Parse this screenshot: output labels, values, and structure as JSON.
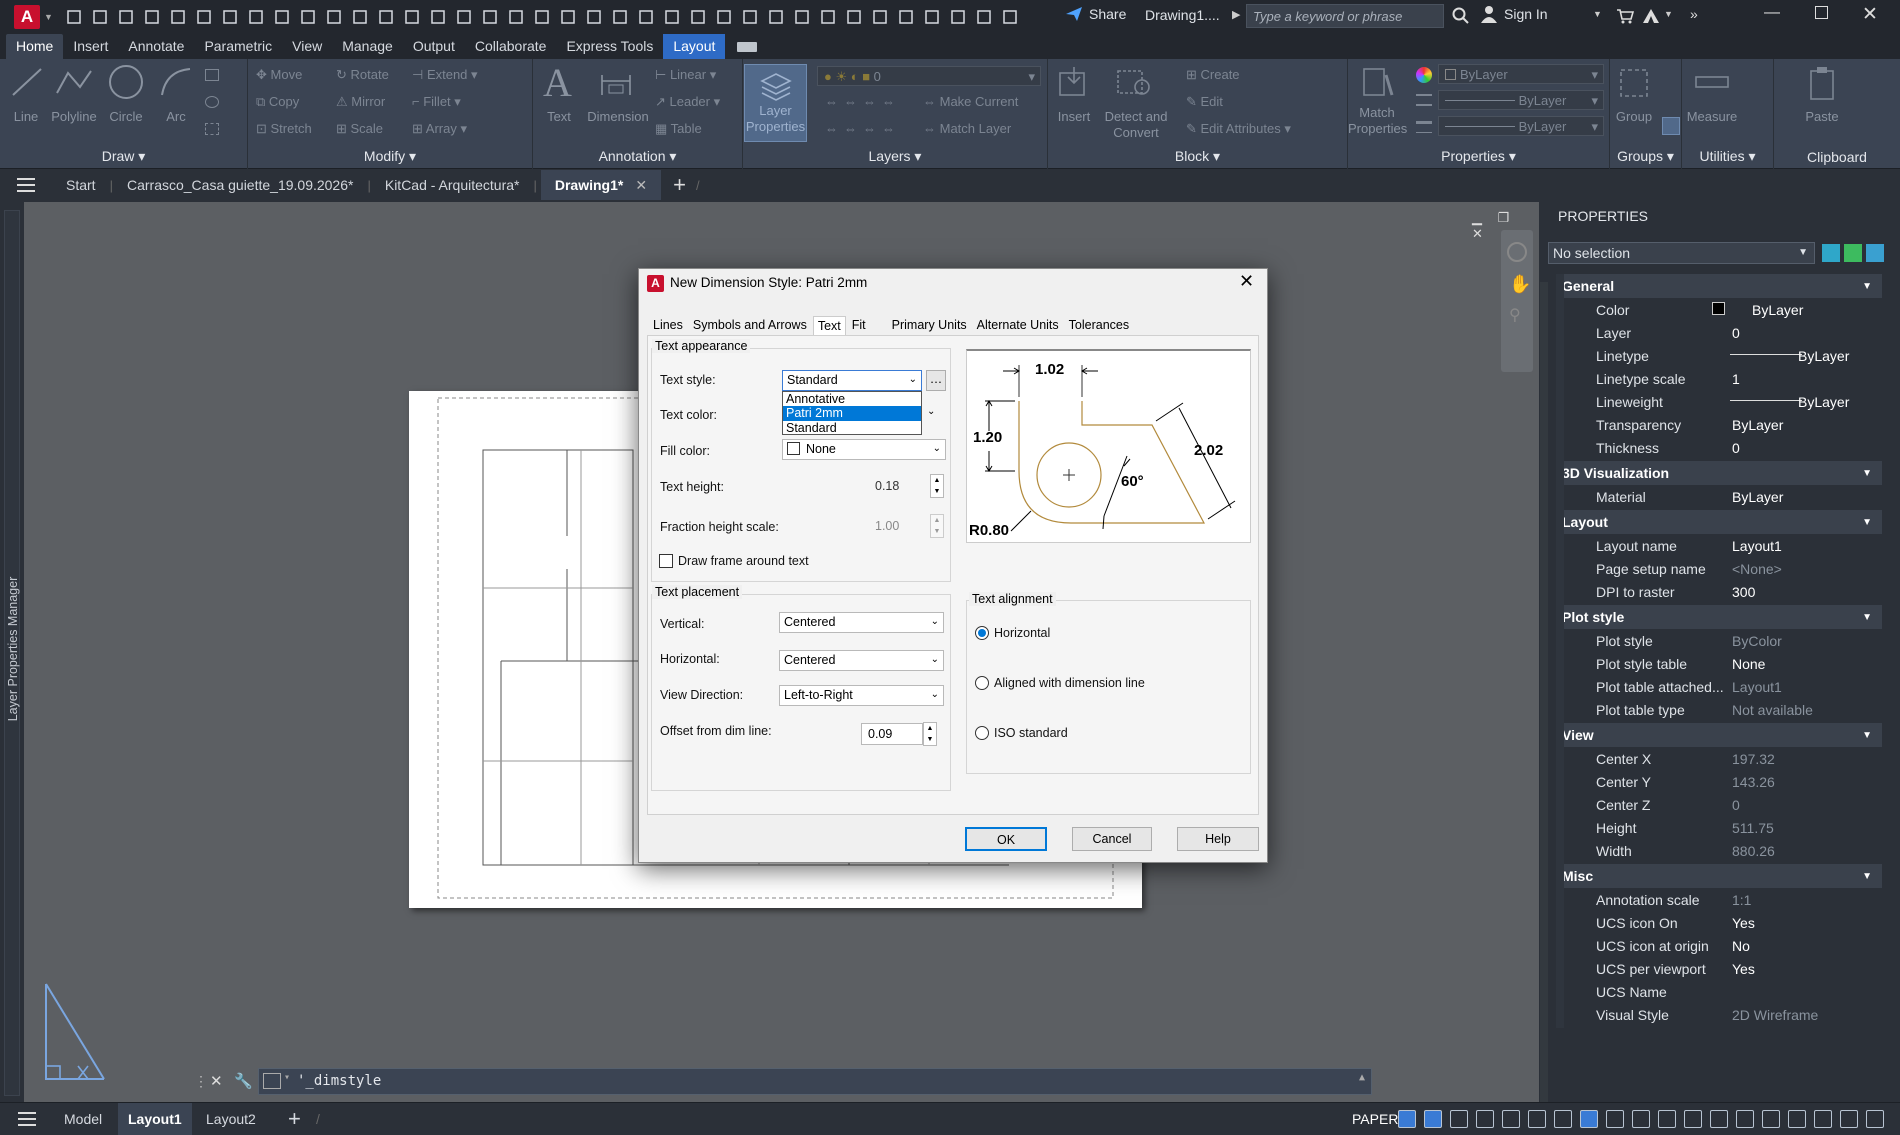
{
  "app": {
    "doc_title": "Drawing1....",
    "search_placeholder": "Type a keyword or phrase",
    "share": "Share",
    "signin": "Sign In"
  },
  "ribbon_tabs": [
    "Home",
    "Insert",
    "Annotate",
    "Parametric",
    "View",
    "Manage",
    "Output",
    "Collaborate",
    "Express Tools",
    "Layout"
  ],
  "ribbon": {
    "draw": {
      "title": "Draw",
      "line": "Line",
      "polyline": "Polyline",
      "circle": "Circle",
      "arc": "Arc"
    },
    "modify": {
      "title": "Modify",
      "move": "Move",
      "rotate": "Rotate",
      "extend": "Extend",
      "copy": "Copy",
      "mirror": "Mirror",
      "fillet": "Fillet",
      "stretch": "Stretch",
      "scale": "Scale",
      "array": "Array"
    },
    "annotation": {
      "title": "Annotation",
      "text": "Text",
      "dimension": "Dimension",
      "linear": "Linear",
      "leader": "Leader",
      "table": "Table"
    },
    "layers": {
      "title": "Layers",
      "layer_properties": "Layer Properties",
      "current_layer": "0",
      "make_current": "Make Current",
      "match_layer": "Match Layer"
    },
    "block": {
      "title": "Block",
      "insert": "Insert",
      "detect": "Detect and Convert",
      "create": "Create",
      "edit": "Edit",
      "edit_attributes": "Edit Attributes"
    },
    "properties": {
      "title": "Properties",
      "match": "Match Properties",
      "color": "ByLayer",
      "linetype": "ByLayer",
      "lineweight": "ByLayer"
    },
    "groups": {
      "title": "Groups",
      "group": "Group"
    },
    "utilities": {
      "title": "Utilities",
      "measure": "Measure"
    },
    "clipboard": {
      "title": "Clipboard",
      "paste": "Paste"
    }
  },
  "doc_tabs": [
    "Start",
    "Carrasco_Casa guiette_19.09.2026*",
    "KitCad - Arquitectura*",
    "Drawing1*"
  ],
  "side_palette": "Layer Properties Manager",
  "dialog": {
    "title": "New Dimension Style: Patri 2mm",
    "tabs": [
      "Lines",
      "Symbols and Arrows",
      "Text",
      "Fit",
      "Primary Units",
      "Alternate Units",
      "Tolerances"
    ],
    "appearance": {
      "title": "Text appearance",
      "style_label": "Text style:",
      "style_value": "Standard",
      "style_options": [
        "Annotative",
        "Patri 2mm",
        "Standard"
      ],
      "color_label": "Text color:",
      "fill_label": "Fill color:",
      "fill_value": "None",
      "height_label": "Text height:",
      "height_value": "0.18",
      "fraction_label": "Fraction height scale:",
      "fraction_value": "1.00",
      "frame_label": "Draw frame around text"
    },
    "placement": {
      "title": "Text placement",
      "vertical_label": "Vertical:",
      "vertical_value": "Centered",
      "horizontal_label": "Horizontal:",
      "horizontal_value": "Centered",
      "view_label": "View Direction:",
      "view_value": "Left-to-Right",
      "offset_label": "Offset from dim line:",
      "offset_value": "0.09"
    },
    "alignment": {
      "title": "Text alignment",
      "options": [
        "Horizontal",
        "Aligned with dimension line",
        "ISO standard"
      ],
      "selected": "Horizontal"
    },
    "preview": {
      "d1": "1.02",
      "d2": "1.20",
      "d3": "2.02",
      "angle": "60°",
      "radius": "R0.80"
    },
    "ok": "OK",
    "cancel": "Cancel",
    "help": "Help"
  },
  "properties_panel": {
    "title": "PROPERTIES",
    "selection": "No selection",
    "sections": [
      {
        "name": "General",
        "rows": [
          [
            "Color",
            "ByLayer"
          ],
          [
            "Layer",
            "0"
          ],
          [
            "Linetype",
            "ByLayer"
          ],
          [
            "Linetype scale",
            "1"
          ],
          [
            "Lineweight",
            "ByLayer"
          ],
          [
            "Transparency",
            "ByLayer"
          ],
          [
            "Thickness",
            "0"
          ]
        ]
      },
      {
        "name": "3D Visualization",
        "rows": [
          [
            "Material",
            "ByLayer"
          ]
        ]
      },
      {
        "name": "Layout",
        "rows": [
          [
            "Layout name",
            "Layout1"
          ],
          [
            "Page setup name",
            "<None>"
          ],
          [
            "DPI to raster",
            "300"
          ]
        ]
      },
      {
        "name": "Plot style",
        "rows": [
          [
            "Plot style",
            "ByColor"
          ],
          [
            "Plot style table",
            "None"
          ],
          [
            "Plot table attached...",
            "Layout1"
          ],
          [
            "Plot table type",
            "Not available"
          ]
        ]
      },
      {
        "name": "View",
        "rows": [
          [
            "Center X",
            "197.32"
          ],
          [
            "Center Y",
            "143.26"
          ],
          [
            "Center Z",
            "0"
          ],
          [
            "Height",
            "511.75"
          ],
          [
            "Width",
            "880.26"
          ]
        ]
      },
      {
        "name": "Misc",
        "rows": [
          [
            "Annotation scale",
            "1:1"
          ],
          [
            "UCS icon On",
            "Yes"
          ],
          [
            "UCS icon at origin",
            "No"
          ],
          [
            "UCS per viewport",
            "Yes"
          ],
          [
            "UCS Name",
            ""
          ],
          [
            "Visual Style",
            "2D Wireframe"
          ]
        ]
      }
    ]
  },
  "command_line": "'_dimstyle",
  "status": {
    "model": "Model",
    "layout1": "Layout1",
    "layout2": "Layout2",
    "paper": "PAPER"
  }
}
